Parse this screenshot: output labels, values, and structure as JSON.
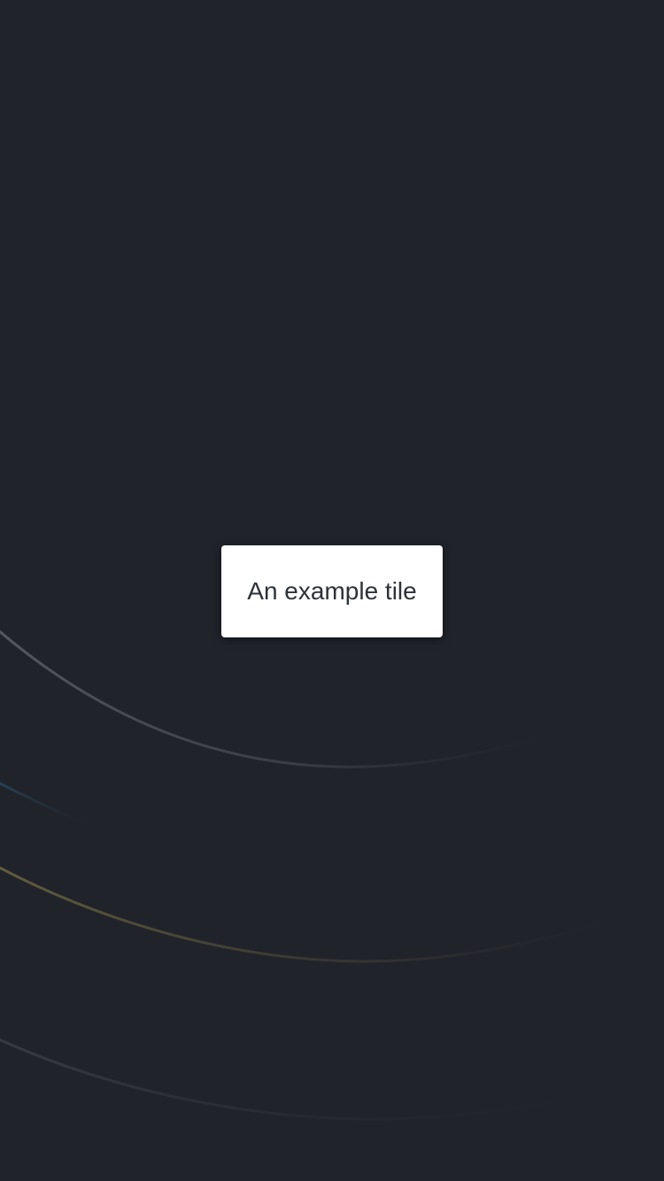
{
  "tile": {
    "label": "An example tile"
  },
  "background": {
    "base_color": "#20232a",
    "arc_colors": [
      "#4a4e57",
      "#2b4b66",
      "#6b6440",
      "#3a3d45"
    ]
  }
}
